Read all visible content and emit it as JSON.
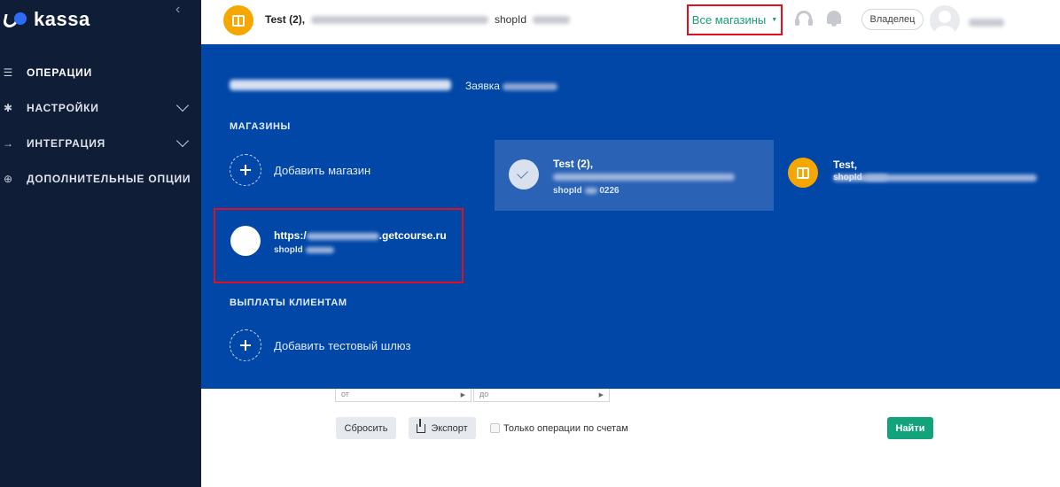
{
  "app": {
    "logo_text": "kassa"
  },
  "sidebar": {
    "items": [
      {
        "label": "ОПЕРАЦИИ",
        "icon": "list-icon",
        "active": true
      },
      {
        "label": "НАСТРОЙКИ",
        "icon": "gear-icon",
        "expandable": true
      },
      {
        "label": "ИНТЕГРАЦИЯ",
        "icon": "arrow-right-icon",
        "expandable": true
      },
      {
        "label": "ДОПОЛНИТЕЛЬНЫЕ ОПЦИИ",
        "icon": "plus-circle-icon"
      }
    ]
  },
  "header": {
    "shop_name": "Test (2),",
    "shop_id_label": "shopId",
    "all_shops_label": "Все магазины",
    "owner_label": "Владелец"
  },
  "panel": {
    "request_label": "Заявка",
    "shops_section_title": "МАГАЗИНЫ",
    "add_shop_label": "Добавить магазин",
    "payouts_section_title": "ВЫПЛАТЫ КЛИЕНТАМ",
    "add_gateway_label": "Добавить тестовый шлюз",
    "shops": [
      {
        "name": "Test (2),",
        "id_label": "shopId",
        "id_visible": "0226",
        "selected": true
      },
      {
        "name": "Test,",
        "id_label": "shopId"
      },
      {
        "name_prefix": "https:/",
        "name_suffix": ".getcourse.ru",
        "id_label": "shopId"
      }
    ]
  },
  "filters": {
    "from_placeholder": "от",
    "to_placeholder": "до",
    "reset_label": "Сбросить",
    "export_label": "Экспорт",
    "only_invoices_label": "Только операции по счетам",
    "find_label": "Найти"
  },
  "colors": {
    "sidebar_bg": "#0f1d36",
    "panel_bg": "#0047a8",
    "accent_green": "#12a37b",
    "highlight_red": "#e01020",
    "shop_orange": "#f5a700"
  }
}
